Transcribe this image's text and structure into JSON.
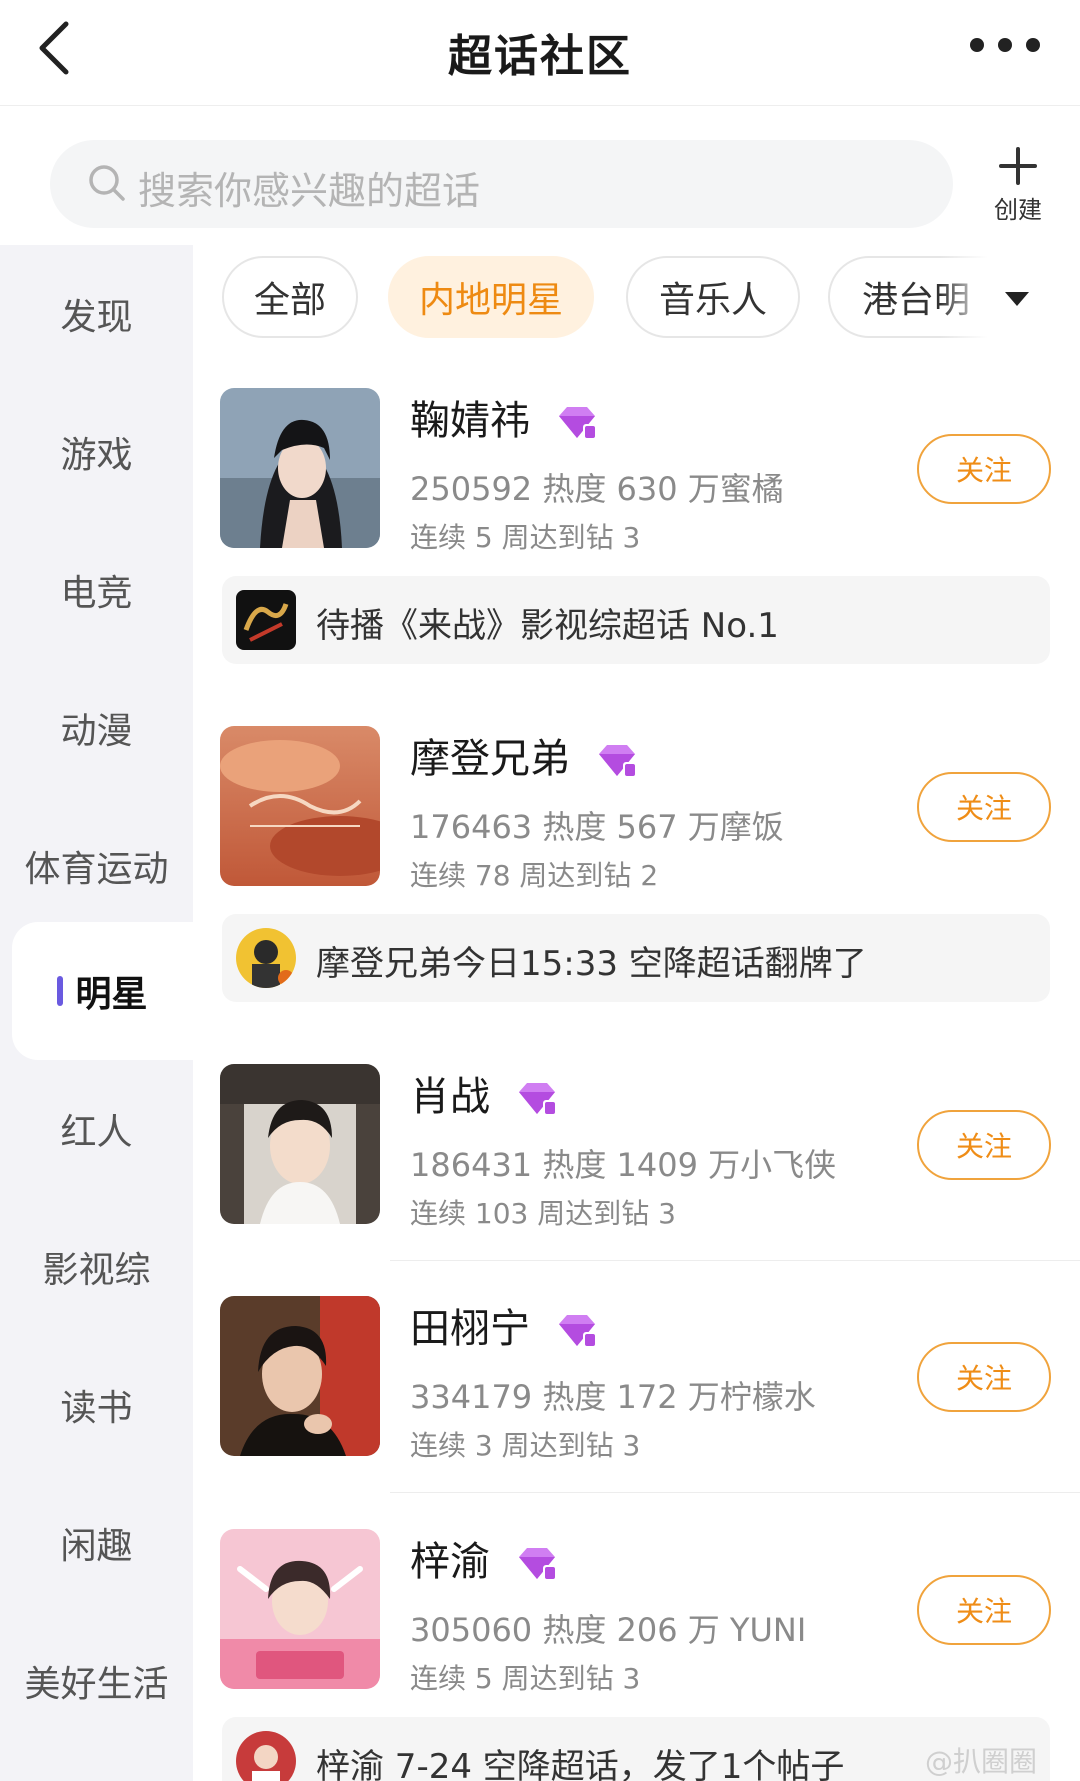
{
  "header": {
    "title": "超话社区",
    "back_icon": "chevron-left-icon",
    "more_icon": "more-dots-icon"
  },
  "search": {
    "placeholder": "搜索你感兴趣的超话",
    "create_label": "创建"
  },
  "sidebar": {
    "items": [
      {
        "label": "发现"
      },
      {
        "label": "游戏"
      },
      {
        "label": "电竞"
      },
      {
        "label": "动漫"
      },
      {
        "label": "体育运动"
      },
      {
        "label": "明星",
        "active": true
      },
      {
        "label": "红人"
      },
      {
        "label": "影视综"
      },
      {
        "label": "读书"
      },
      {
        "label": "闲趣"
      },
      {
        "label": "美好生活"
      }
    ]
  },
  "tabs": [
    {
      "label": "全部"
    },
    {
      "label": "内地明星",
      "active": true
    },
    {
      "label": "音乐人"
    },
    {
      "label": "港台明"
    }
  ],
  "follow_label": "关注",
  "communities": [
    {
      "name": "鞠婧祎",
      "stats": "250592 热度 630 万蜜橘",
      "streak": "连续 5 周达到钻 3",
      "notice": "待播《来战》影视综超话 No.1"
    },
    {
      "name": "摩登兄弟",
      "stats": "176463 热度 567 万摩饭",
      "streak": "连续 78 周达到钻 2",
      "notice": "摩登兄弟今日15:33 空降超话翻牌了"
    },
    {
      "name": "肖战",
      "stats": "186431 热度 1409 万小飞侠",
      "streak": "连续 103 周达到钻 3"
    },
    {
      "name": "田栩宁",
      "stats": "334179 热度 172 万柠檬水",
      "streak": "连续 3 周达到钻 3"
    },
    {
      "name": "梓渝",
      "stats": "305060 热度 206 万 YUNI",
      "streak": "连续 5 周达到钻 3",
      "notice": "梓渝 7-24 空降超话，发了1个帖子"
    }
  ],
  "watermark": "@扒圈圈",
  "colors": {
    "accent": "#ef8d17",
    "tab_active_bg": "#fff1df",
    "sidebar_bg": "#f3f3f7",
    "diamond": "#b44ce0"
  }
}
